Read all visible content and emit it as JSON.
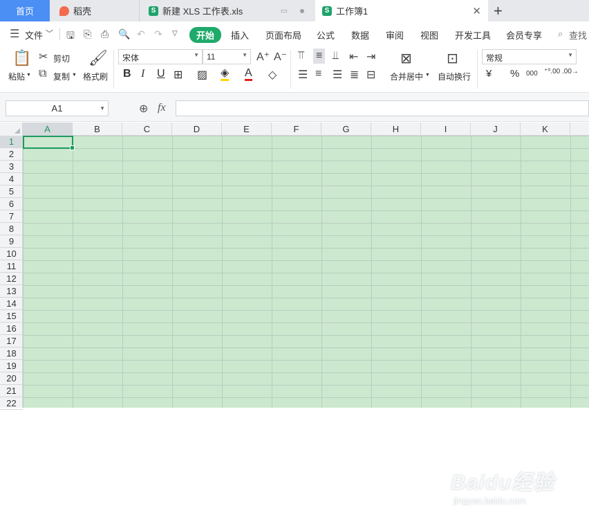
{
  "tabs": [
    {
      "label": "首页"
    },
    {
      "label": "稻壳",
      "icon": "docer-icon"
    },
    {
      "label": "新建 XLS 工作表.xls",
      "icon": "sheet-icon"
    },
    {
      "label": "工作簿1",
      "icon": "sheet-icon"
    }
  ],
  "menu": {
    "file": "文件",
    "items": [
      "开始",
      "插入",
      "页面布局",
      "公式",
      "数据",
      "审阅",
      "视图",
      "开发工具",
      "会员专享"
    ],
    "active": "开始",
    "search": "查找"
  },
  "ribbon": {
    "paste": "粘贴",
    "cut": "剪切",
    "copy": "复制",
    "format_painter": "格式刷",
    "font_name": "宋体",
    "font_size": "11",
    "merge_center": "合并居中",
    "wrap_text": "自动换行",
    "number_format": "常规",
    "currency": "¥",
    "percent": "%",
    "thousands": "000"
  },
  "formula_bar": {
    "name_box": "A1",
    "fx": "fx",
    "value": ""
  },
  "grid": {
    "columns": [
      "A",
      "B",
      "C",
      "D",
      "E",
      "F",
      "G",
      "H",
      "I",
      "J",
      "K"
    ],
    "rows": [
      "1",
      "2",
      "3",
      "4",
      "5",
      "6",
      "7",
      "8",
      "9",
      "10",
      "11",
      "12",
      "13",
      "14",
      "15",
      "16",
      "17",
      "18",
      "19",
      "20",
      "21",
      "22"
    ],
    "selected_cell": "A1"
  },
  "watermark": {
    "logo": "Baidu经验",
    "url": "jingyan.baidu.com"
  },
  "colors": {
    "accent_green": "#1eaa6a",
    "home_tab_blue": "#4b8ff4",
    "sheet_bg": "#cce8cf"
  }
}
